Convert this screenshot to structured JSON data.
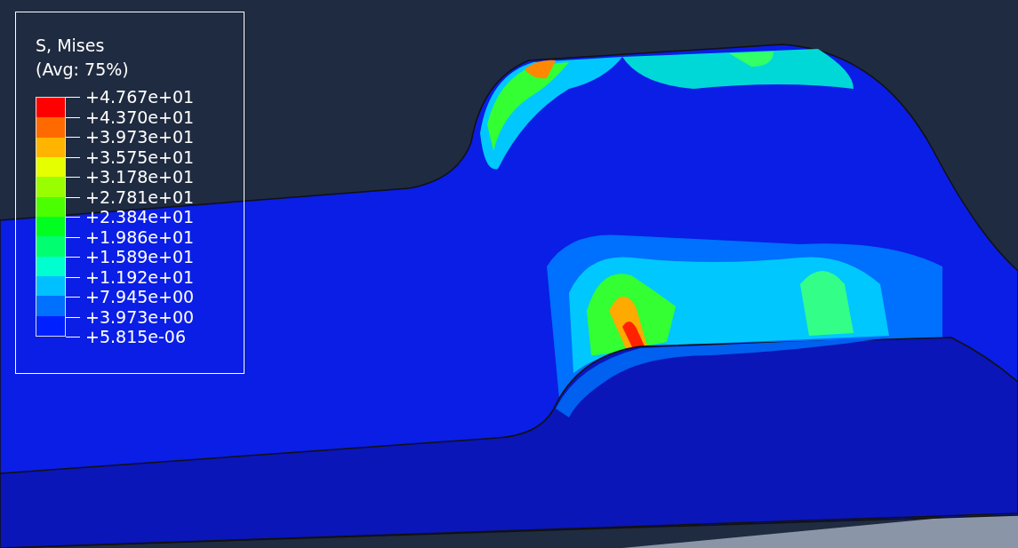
{
  "legend": {
    "title": "S, Mises",
    "subtitle": "(Avg: 75%)",
    "bands": [
      {
        "color": "#ff0000"
      },
      {
        "color": "#ff6a00"
      },
      {
        "color": "#ffb400"
      },
      {
        "color": "#e6ff00"
      },
      {
        "color": "#99ff00"
      },
      {
        "color": "#4cff00"
      },
      {
        "color": "#00ff20"
      },
      {
        "color": "#00ff70"
      },
      {
        "color": "#00ffd0"
      },
      {
        "color": "#00c0ff"
      },
      {
        "color": "#0070ff"
      },
      {
        "color": "#0020ff"
      }
    ],
    "labels": [
      "+4.767e+01",
      "+4.370e+01",
      "+3.973e+01",
      "+3.575e+01",
      "+3.178e+01",
      "+2.781e+01",
      "+2.384e+01",
      "+1.986e+01",
      "+1.589e+01",
      "+1.192e+01",
      "+7.945e+00",
      "+3.973e+00",
      "+5.815e-06"
    ]
  }
}
